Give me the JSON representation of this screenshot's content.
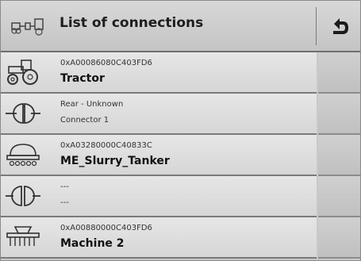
{
  "header": {
    "title": "List of connections",
    "icon": "connections-icon",
    "back_icon": "back-arrow-icon"
  },
  "connections": [
    {
      "id": "0xA00086080C403FD6",
      "name": "Tractor",
      "icon": "tractor-icon"
    },
    {
      "id": "Rear - Unknown",
      "name": "Connector 1",
      "icon": "connector-icon"
    },
    {
      "id": "0xA03280000C40833C",
      "name": "ME_Slurry_Tanker",
      "icon": "tanker-icon"
    },
    {
      "id": "---",
      "name": "---",
      "icon": "double-connector-icon"
    },
    {
      "id": "0xA00880000C403FD6",
      "name": "Machine 2",
      "icon": "seeder-icon"
    }
  ]
}
